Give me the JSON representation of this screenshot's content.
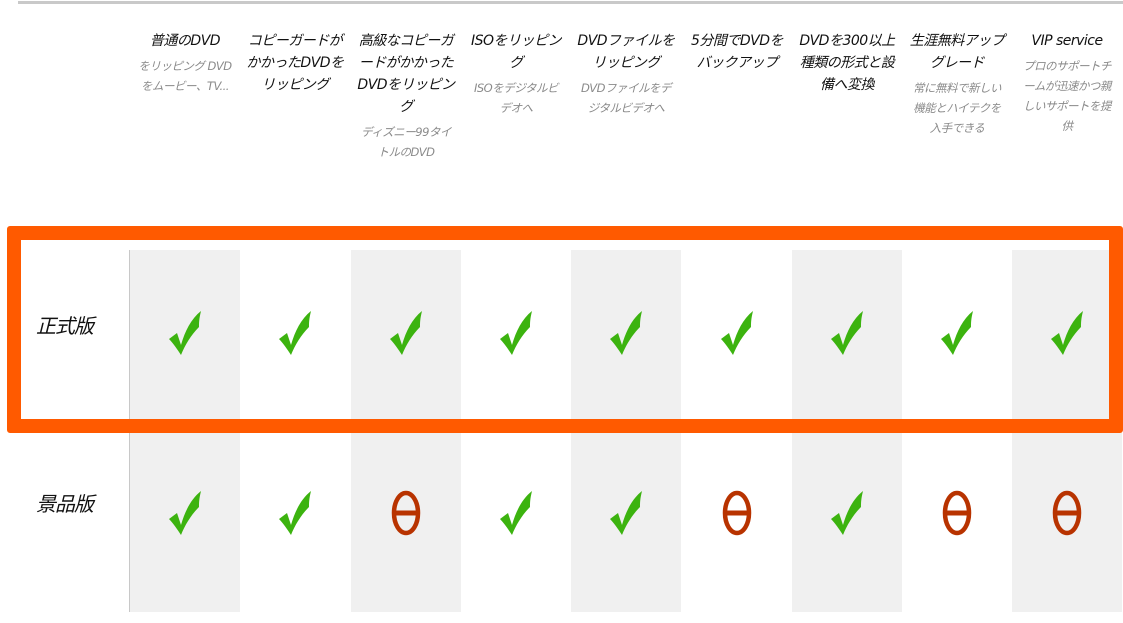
{
  "colors": {
    "check": "#3cb30f",
    "unavailable": "#b83300",
    "highlight": "#ff5a00",
    "stripe": "#f0f0f0"
  },
  "columns": [
    {
      "title": "普通のDVD",
      "subtitle": "をリッピング DVDをムービー、TV..."
    },
    {
      "title": "コピーガードがかかったDVDをリッピング",
      "subtitle": ""
    },
    {
      "title": "高級なコピーガードがかかったDVDをリッピング",
      "subtitle": "ディズニー99タイトルのDVD"
    },
    {
      "title": "ISOをリッピング",
      "subtitle": "ISOをデジタルビデオへ"
    },
    {
      "title": "DVDファイルをリッピング",
      "subtitle": "DVDファイルをデジタルビデオへ"
    },
    {
      "title": "5分間でDVDをバックアップ",
      "subtitle": ""
    },
    {
      "title": "DVDを300以上種類の形式と設備へ変換",
      "subtitle": ""
    },
    {
      "title": "生涯無料アップグレード",
      "subtitle": "常に無料で新しい機能とハイテクを入手できる"
    },
    {
      "title": "VIP service",
      "subtitle": "プロのサポートチームが迅速かつ親しいサポートを提供"
    }
  ],
  "rows": [
    {
      "label": "正式版",
      "highlighted": true,
      "cells": [
        "check-icon",
        "check-icon",
        "check-icon",
        "check-icon",
        "check-icon",
        "check-icon",
        "check-icon",
        "check-icon",
        "check-icon"
      ]
    },
    {
      "label": "景品版",
      "highlighted": false,
      "cells": [
        "check-icon",
        "check-icon",
        "unavailable-icon",
        "check-icon",
        "check-icon",
        "unavailable-icon",
        "check-icon",
        "unavailable-icon",
        "unavailable-icon"
      ]
    }
  ]
}
